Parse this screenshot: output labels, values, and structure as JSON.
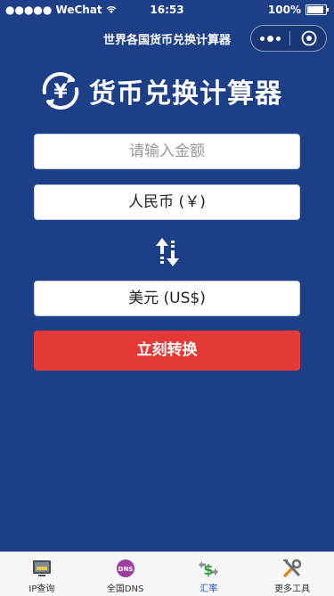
{
  "status_bar": {
    "carrier": "●●●●● WeChat",
    "time": "16:53",
    "battery_percent": "100%",
    "battery_level": 1.0
  },
  "nav": {
    "title": "世界各国货币兑换计算器",
    "more_icon": "more-dots-icon",
    "close_icon": "target-close-icon"
  },
  "logo": {
    "icon": "yen-exchange-icon",
    "text": "货币兑换计算器"
  },
  "form": {
    "amount_placeholder": "请输入金额",
    "from_currency": "人民币 (￥)",
    "swap_icon": "swap-arrows-icon",
    "to_currency": "美元 (US$)",
    "convert_label": "立刻转换"
  },
  "tabbar": {
    "items": [
      {
        "label": "IP查询",
        "icon": "ip-query-icon",
        "active": false
      },
      {
        "label": "全国DNS",
        "icon": "dns-icon",
        "active": false
      },
      {
        "label": "汇率",
        "icon": "exchange-rate-icon",
        "active": true
      },
      {
        "label": "更多工具",
        "icon": "tools-icon",
        "active": false
      }
    ]
  },
  "colors": {
    "background": "#1d3f87",
    "button": "#e53935",
    "tab_active": "#1f4fb8"
  }
}
